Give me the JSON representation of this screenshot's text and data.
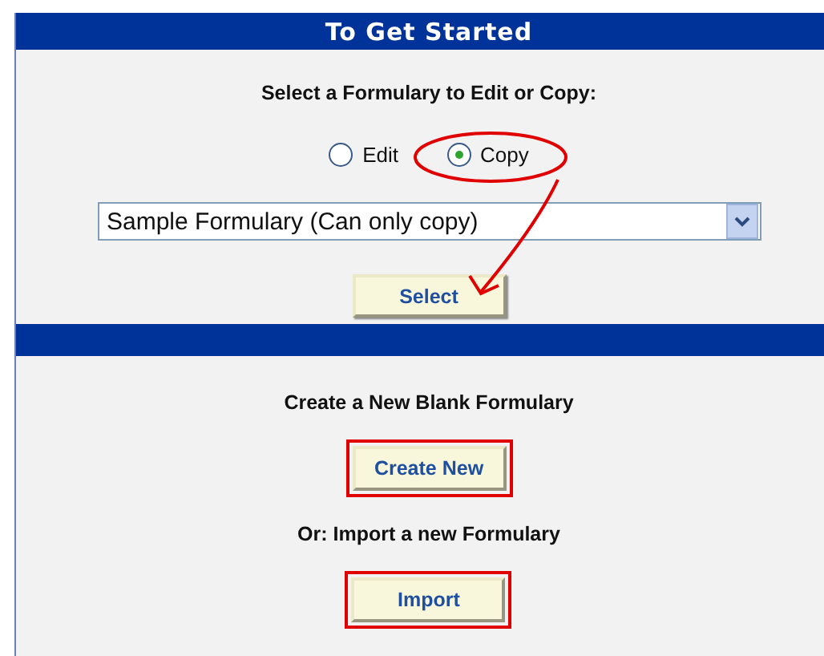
{
  "title": "To Get Started",
  "edit_section": {
    "prompt": "Select a Formulary to Edit or Copy:",
    "modes": [
      {
        "label": "Edit",
        "selected": false,
        "circled": false
      },
      {
        "label": "Copy",
        "selected": true,
        "circled": true
      }
    ],
    "dropdown": {
      "value": "Sample Formulary (Can only copy)"
    },
    "button": {
      "label": "Select",
      "arrow_pointing": true
    }
  },
  "create_section": [
    {
      "prompt": "Create a New Blank Formulary",
      "button": "Create New",
      "boxed": true
    },
    {
      "prompt": "Or: Import a new Formulary",
      "button": "Import",
      "boxed": true
    }
  ]
}
